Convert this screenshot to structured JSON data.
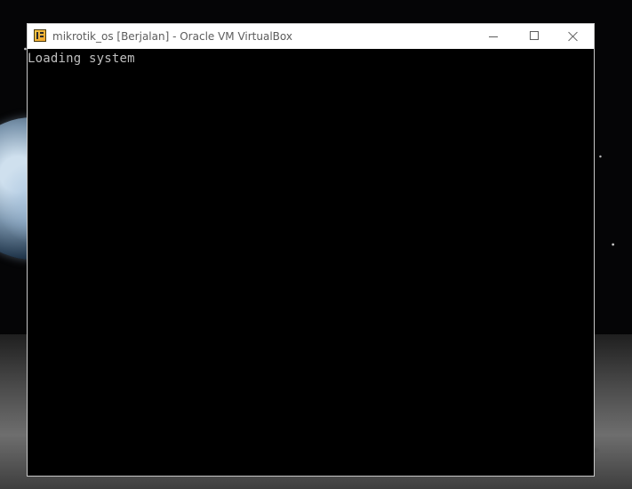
{
  "window": {
    "title": "mikrotik_os [Berjalan] - Oracle VM VirtualBox",
    "icon": "virtualbox-icon"
  },
  "controls": {
    "minimize": "minimize-icon",
    "maximize": "maximize-icon",
    "close": "close-icon"
  },
  "console": {
    "text": "Loading system"
  },
  "colors": {
    "titlebar": "#ffffff",
    "screen": "#000000",
    "console_text": "#bfbfbf"
  }
}
